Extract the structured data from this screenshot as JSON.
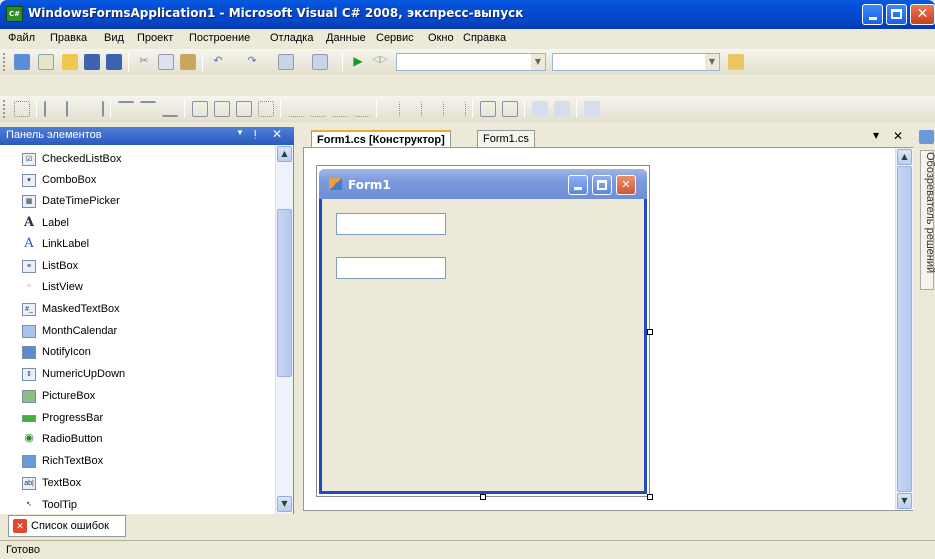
{
  "window": {
    "title": "WindowsFormsApplication1 - Microsoft Visual C# 2008, экспресс-выпуск",
    "app_icon": "C#"
  },
  "menu": [
    "Файл",
    "Правка",
    "Вид",
    "Проект",
    "Построение",
    "Отладка",
    "Данные",
    "Сервис",
    "Окно",
    "Справка"
  ],
  "toolbox": {
    "title": "Панель элементов",
    "items": [
      {
        "label": "CheckedListBox",
        "icon": "checkedlistbox-icon"
      },
      {
        "label": "ComboBox",
        "icon": "combobox-icon"
      },
      {
        "label": "DateTimePicker",
        "icon": "datetimepicker-icon"
      },
      {
        "label": "Label",
        "icon": "label-icon"
      },
      {
        "label": "LinkLabel",
        "icon": "linklabel-icon"
      },
      {
        "label": "ListBox",
        "icon": "listbox-icon"
      },
      {
        "label": "ListView",
        "icon": "listview-icon"
      },
      {
        "label": "MaskedTextBox",
        "icon": "maskedtextbox-icon"
      },
      {
        "label": "MonthCalendar",
        "icon": "monthcalendar-icon"
      },
      {
        "label": "NotifyIcon",
        "icon": "notifyicon-icon"
      },
      {
        "label": "NumericUpDown",
        "icon": "numericupdown-icon"
      },
      {
        "label": "PictureBox",
        "icon": "picturebox-icon"
      },
      {
        "label": "ProgressBar",
        "icon": "progressbar-icon"
      },
      {
        "label": "RadioButton",
        "icon": "radiobutton-icon"
      },
      {
        "label": "RichTextBox",
        "icon": "richtextbox-icon"
      },
      {
        "label": "TextBox",
        "icon": "textbox-icon"
      },
      {
        "label": "ToolTip",
        "icon": "tooltip-icon"
      }
    ]
  },
  "tabs": {
    "designer": "Form1.cs [Конструктор]",
    "code": "Form1.cs"
  },
  "form": {
    "title": "Form1"
  },
  "solution_explorer_tab": "Обозреватель решений",
  "error_list_tab": "Список ошибок",
  "status": "Готово",
  "colors": {
    "titlebar": "#0550D8",
    "toolbox_header": "#3C6CCB",
    "form_border": "#1E4BBE",
    "form_titlebar": "#7C9BDD",
    "status_bar": "#ECE9D8"
  }
}
